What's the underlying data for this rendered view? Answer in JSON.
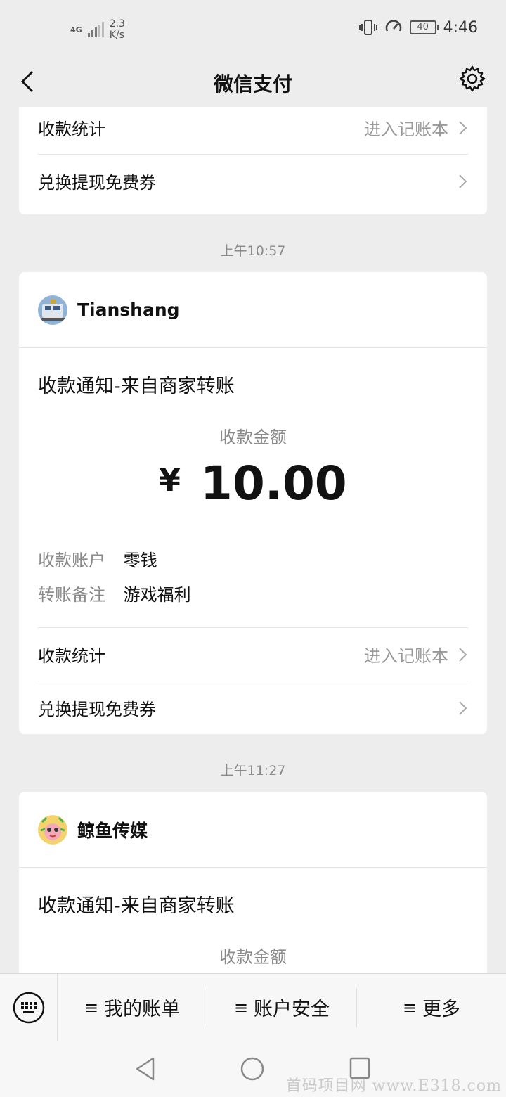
{
  "status_bar": {
    "network": "4G",
    "speed_value": "2.3",
    "speed_unit": "K/s",
    "battery": "40",
    "time": "4:46"
  },
  "nav": {
    "title": "微信支付"
  },
  "cards": [
    {
      "rows": [
        {
          "label": "收款统计",
          "right": "进入记账本"
        },
        {
          "label": "兑换提现免费券",
          "right": ""
        }
      ]
    },
    {
      "time": "上午10:57",
      "sender": "Tianshang",
      "notice_title": "收款通知-来自商家转账",
      "amount_label": "收款金额",
      "currency": "¥",
      "amount": "10.00",
      "details": [
        {
          "key": "收款账户",
          "value": "零钱"
        },
        {
          "key": "转账备注",
          "value": "游戏福利"
        }
      ],
      "rows": [
        {
          "label": "收款统计",
          "right": "进入记账本"
        },
        {
          "label": "兑换提现免费券",
          "right": ""
        }
      ]
    },
    {
      "time": "上午11:27",
      "sender": "鲸鱼传媒",
      "notice_title": "收款通知-来自商家转账",
      "amount_label": "收款金额"
    }
  ],
  "menu": {
    "items": [
      {
        "icon": "≡",
        "label": "我的账单"
      },
      {
        "icon": "≡",
        "label": "账户安全"
      },
      {
        "icon": "≡",
        "label": "更多"
      }
    ]
  },
  "watermark": "首码项目网 www.E318.com",
  "colors": {
    "background": "#ededed",
    "card": "#ffffff",
    "muted_text": "#8a8a8a"
  }
}
